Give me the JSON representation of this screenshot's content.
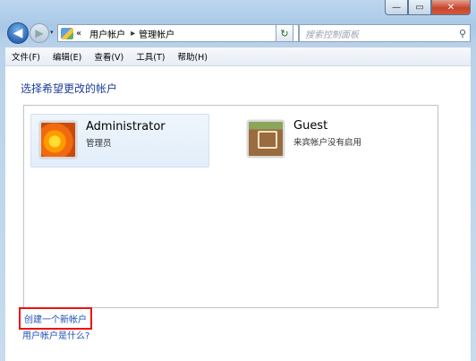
{
  "window": {
    "caption_buttons": {
      "minimize": "—",
      "maximize": "▭",
      "close": "✕"
    }
  },
  "nav": {
    "back_icon": "◀",
    "forward_icon": "▶",
    "recent_icon": "▾",
    "address": {
      "prefix": "«",
      "crumbs": [
        "用户帐户",
        "管理帐户"
      ],
      "separator": "▸",
      "dropdown_icon": "▾"
    },
    "refresh_icon": "↻",
    "search": {
      "placeholder": "搜索控制面板",
      "icon": "⚲"
    }
  },
  "menubar": [
    "文件(F)",
    "编辑(E)",
    "查看(V)",
    "工具(T)",
    "帮助(H)"
  ],
  "main": {
    "heading": "选择希望更改的帐户",
    "accounts": [
      {
        "name": "Administrator",
        "role": "管理员",
        "icon": "flower-avatar-icon"
      },
      {
        "name": "Guest",
        "role": "来宾帐户没有启用",
        "icon": "briefcase-avatar-icon"
      }
    ],
    "links": {
      "create": "创建一个新帐户",
      "what": "用户帐户是什么?"
    }
  },
  "colors": {
    "accent_link": "#1e50b4",
    "highlight_box": "#e11111",
    "heading": "#1e3e9c"
  }
}
